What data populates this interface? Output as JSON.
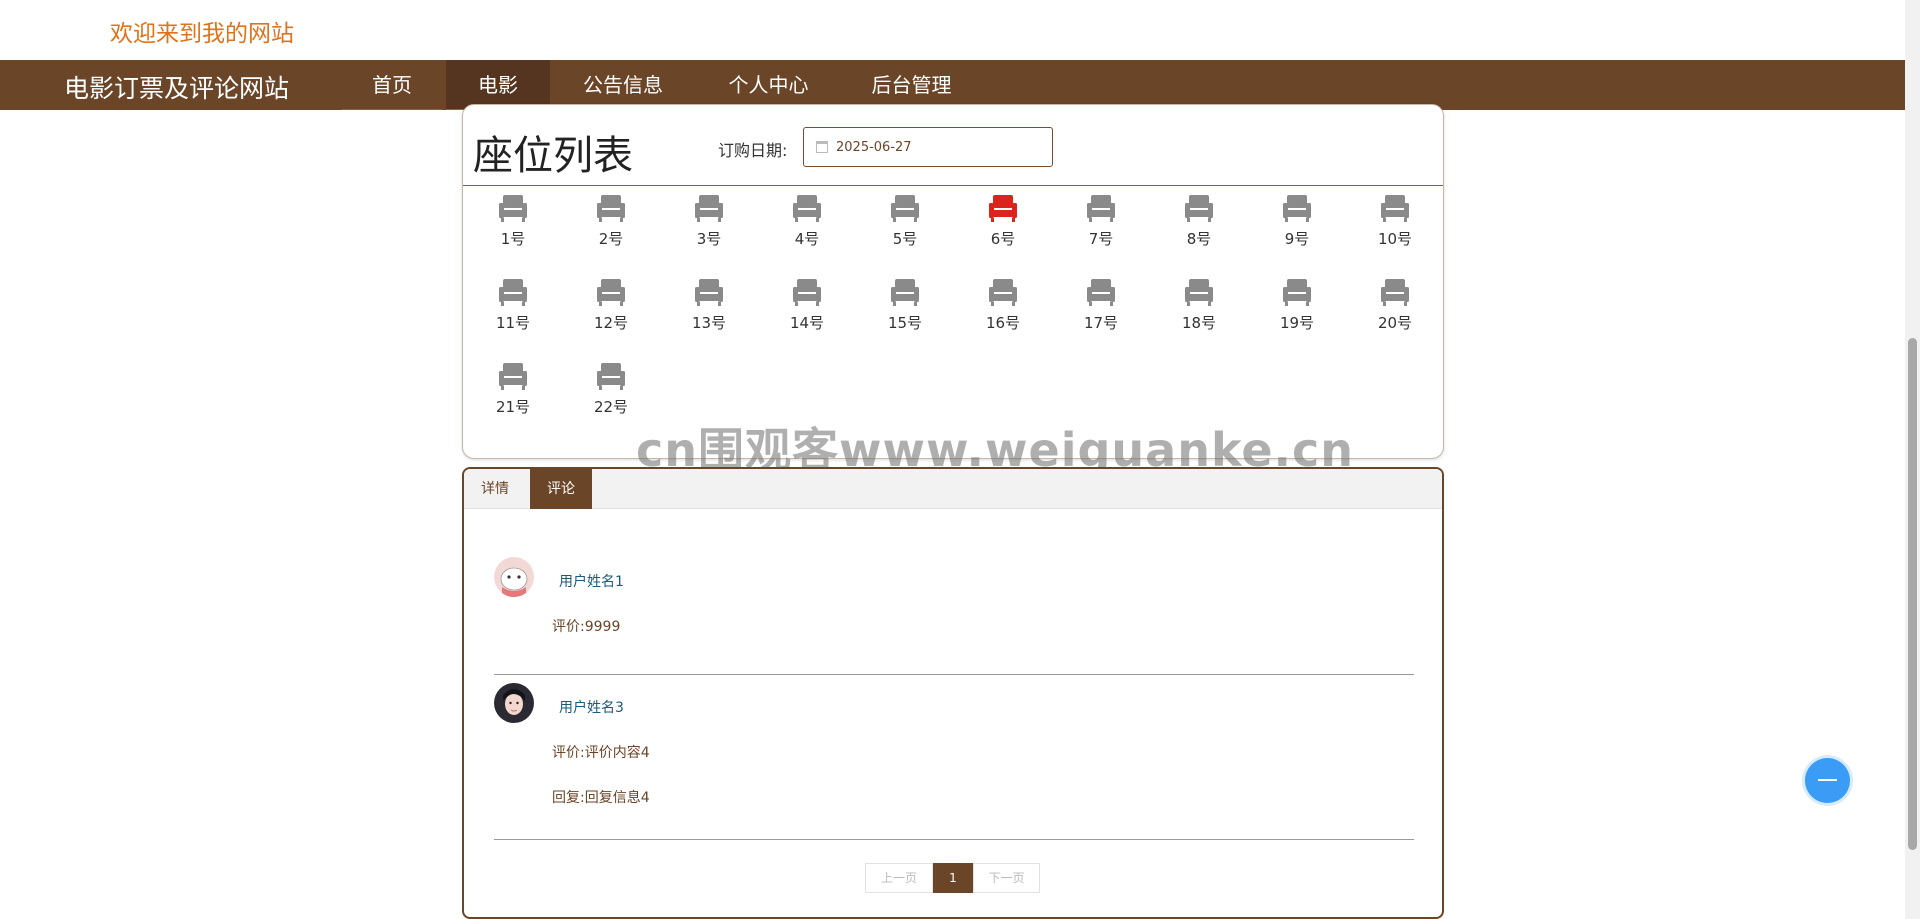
{
  "header": {
    "welcome": "欢迎来到我的网站"
  },
  "nav": {
    "brand": "电影订票及评论网站",
    "items": [
      {
        "label": "首页",
        "active": false
      },
      {
        "label": "电影",
        "active": true
      },
      {
        "label": "公告信息",
        "active": false
      },
      {
        "label": "个人中心",
        "active": false
      },
      {
        "label": "后台管理",
        "active": false
      }
    ]
  },
  "seats": {
    "title": "座位列表",
    "date_label": "订购日期:",
    "date_value": "2025-06-27",
    "list": [
      {
        "label": "1号",
        "status": "available"
      },
      {
        "label": "2号",
        "status": "available"
      },
      {
        "label": "3号",
        "status": "available"
      },
      {
        "label": "4号",
        "status": "available"
      },
      {
        "label": "5号",
        "status": "available"
      },
      {
        "label": "6号",
        "status": "booked"
      },
      {
        "label": "7号",
        "status": "available"
      },
      {
        "label": "8号",
        "status": "available"
      },
      {
        "label": "9号",
        "status": "available"
      },
      {
        "label": "10号",
        "status": "available"
      },
      {
        "label": "11号",
        "status": "available"
      },
      {
        "label": "12号",
        "status": "available"
      },
      {
        "label": "13号",
        "status": "available"
      },
      {
        "label": "14号",
        "status": "available"
      },
      {
        "label": "15号",
        "status": "available"
      },
      {
        "label": "16号",
        "status": "available"
      },
      {
        "label": "17号",
        "status": "available"
      },
      {
        "label": "18号",
        "status": "available"
      },
      {
        "label": "19号",
        "status": "available"
      },
      {
        "label": "20号",
        "status": "available"
      },
      {
        "label": "21号",
        "status": "available"
      },
      {
        "label": "22号",
        "status": "available"
      }
    ]
  },
  "watermark": "cn围观客www.weiguanke.cn",
  "tabs": [
    {
      "label": "详情",
      "active": false
    },
    {
      "label": "评论",
      "active": true
    }
  ],
  "comments": [
    {
      "user": "用户姓名1",
      "rating": "评价:9999",
      "reply": ""
    },
    {
      "user": "用户姓名3",
      "rating": "评价:评价内容4",
      "reply": "回复:回复信息4"
    }
  ],
  "pagination": {
    "prev": "上一页",
    "current": "1",
    "next": "下一页"
  },
  "colors": {
    "brand_brown": "#6b4527",
    "nav_active": "#553520",
    "welcome_orange": "#e0731a",
    "seat_available": "#8a8a8a",
    "seat_booked": "#d9251c",
    "user_link": "#1a5a7a",
    "float_button": "#3b9cf5"
  },
  "icons": {
    "seat": "armchair-icon",
    "date": "calendar-icon",
    "float": "back-to-top-icon"
  }
}
